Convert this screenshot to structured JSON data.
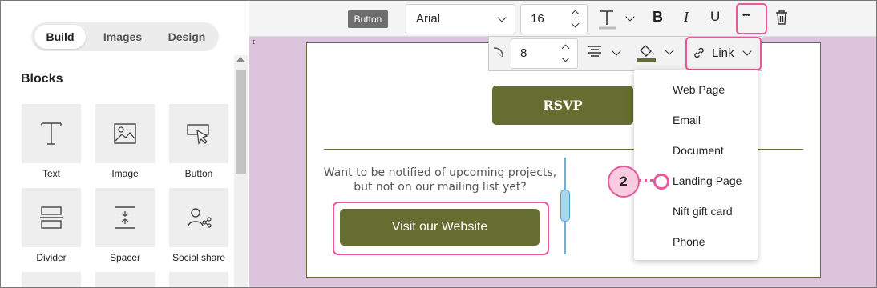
{
  "left_panel": {
    "tabs": [
      "Build",
      "Images",
      "Design"
    ],
    "active_tab": "Build",
    "section_title": "Blocks",
    "blocks": [
      {
        "label": "Text",
        "icon": "text-icon"
      },
      {
        "label": "Image",
        "icon": "image-icon"
      },
      {
        "label": "Button",
        "icon": "button-cursor-icon"
      },
      {
        "label": "Divider",
        "icon": "divider-icon"
      },
      {
        "label": "Spacer",
        "icon": "spacer-icon"
      },
      {
        "label": "Social share",
        "icon": "social-share-icon"
      }
    ]
  },
  "toolbar": {
    "selected_element": "Button",
    "font_family": "Arial",
    "font_size": "16",
    "collapse_glyph": "‹",
    "more_glyph": "•••"
  },
  "subtoolbar": {
    "padding_value": "8",
    "link_label": "Link"
  },
  "canvas": {
    "rsvp_label": "RSVP",
    "notify_text": "Want to be notified of upcoming projects, but not on our mailing list yet?",
    "visit_label": "Visit our Website"
  },
  "link_menu": {
    "items": [
      "Web Page",
      "Email",
      "Document",
      "Landing Page",
      "Nift gift card",
      "Phone"
    ]
  },
  "callout": {
    "number": "2"
  },
  "colors": {
    "accent_pink": "#e8589a",
    "button_olive": "#656d30",
    "canvas_bg": "#dcc4dd"
  }
}
